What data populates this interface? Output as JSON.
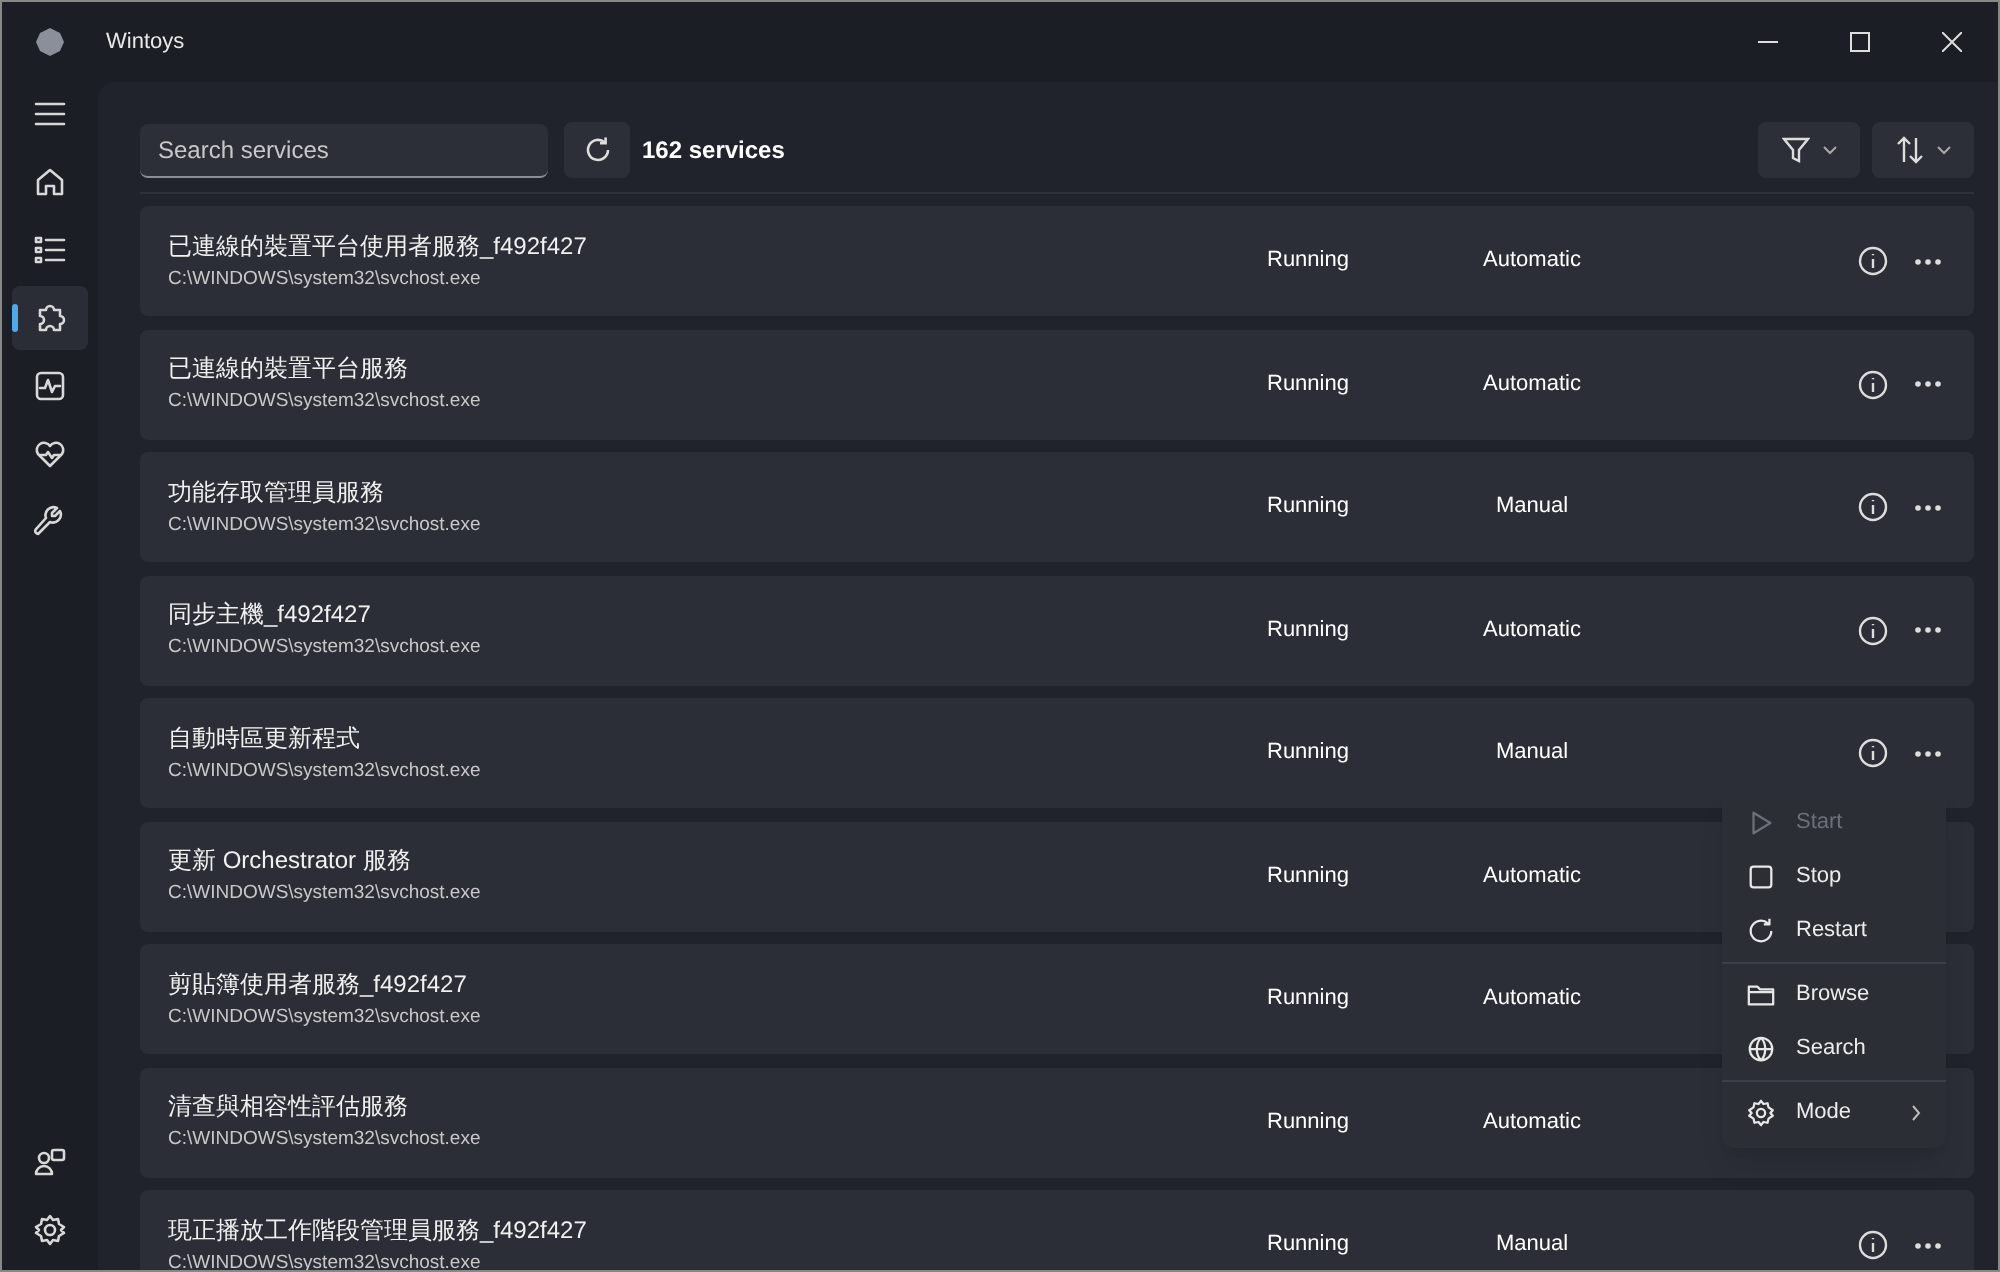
{
  "window": {
    "title": "Wintoys"
  },
  "sidebar": {
    "items": [
      {
        "kind": "menu",
        "selected": false
      },
      {
        "kind": "home",
        "selected": false
      },
      {
        "kind": "list",
        "selected": false
      },
      {
        "kind": "puzzle",
        "selected": true
      },
      {
        "kind": "activity",
        "selected": false
      },
      {
        "kind": "health",
        "selected": false
      },
      {
        "kind": "wrench",
        "selected": false
      }
    ],
    "footer": [
      {
        "kind": "accounts",
        "selected": false
      },
      {
        "kind": "settings",
        "selected": false
      }
    ]
  },
  "toolbar": {
    "search": {
      "placeholder": "Search services"
    },
    "count": "162 services"
  },
  "services": [
    {
      "name": "已連線的裝置平台使用者服務_f492f427",
      "path": "C:\\WINDOWS\\system32\\svchost.exe",
      "status": "Running",
      "startup": "Automatic"
    },
    {
      "name": "已連線的裝置平台服務",
      "path": "C:\\WINDOWS\\system32\\svchost.exe",
      "status": "Running",
      "startup": "Automatic"
    },
    {
      "name": "功能存取管理員服務",
      "path": "C:\\WINDOWS\\system32\\svchost.exe",
      "status": "Running",
      "startup": "Manual"
    },
    {
      "name": "同步主機_f492f427",
      "path": "C:\\WINDOWS\\system32\\svchost.exe",
      "status": "Running",
      "startup": "Automatic"
    },
    {
      "name": "自動時區更新程式",
      "path": "C:\\WINDOWS\\system32\\svchost.exe",
      "status": "Running",
      "startup": "Manual"
    },
    {
      "name": "更新 Orchestrator 服務",
      "path": "C:\\WINDOWS\\system32\\svchost.exe",
      "status": "Running",
      "startup": "Automatic"
    },
    {
      "name": "剪貼簿使用者服務_f492f427",
      "path": "C:\\WINDOWS\\system32\\svchost.exe",
      "status": "Running",
      "startup": "Automatic"
    },
    {
      "name": "清查與相容性評估服務",
      "path": "C:\\WINDOWS\\system32\\svchost.exe",
      "status": "Running",
      "startup": "Automatic"
    },
    {
      "name": "現正播放工作階段管理員服務_f492f427",
      "path": "C:\\WINDOWS\\system32\\svchost.exe",
      "status": "Running",
      "startup": "Manual"
    }
  ],
  "context_menu": {
    "items": [
      {
        "kind": "start",
        "label": "Start",
        "disabled": true
      },
      {
        "kind": "stop",
        "label": "Stop",
        "disabled": false
      },
      {
        "kind": "restart",
        "label": "Restart",
        "disabled": false
      },
      {
        "kind": "separator"
      },
      {
        "kind": "browse",
        "label": "Browse",
        "disabled": false
      },
      {
        "kind": "search",
        "label": "Search",
        "disabled": false
      },
      {
        "kind": "separator"
      },
      {
        "kind": "mode",
        "label": "Mode",
        "disabled": false,
        "submenu": true
      }
    ]
  }
}
